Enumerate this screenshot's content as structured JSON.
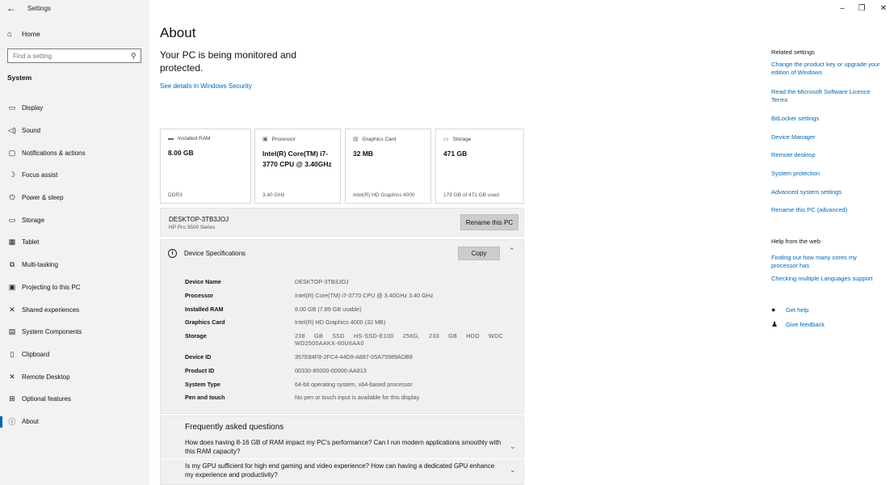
{
  "window": {
    "title": "Settings",
    "back_icon": "arrow-left-icon",
    "controls": {
      "minimize": "–",
      "restore": "❐",
      "close": "✕"
    }
  },
  "sidebar": {
    "home_label": "Home",
    "search_placeholder": "Find a setting",
    "section_label": "System",
    "items": [
      {
        "label": "Display",
        "icon": "monitor-icon",
        "glyph": "▭"
      },
      {
        "label": "Sound",
        "icon": "speaker-icon",
        "glyph": "◁)"
      },
      {
        "label": "Notifications & actions",
        "icon": "notification-icon",
        "glyph": "▢"
      },
      {
        "label": "Focus assist",
        "icon": "moon-icon",
        "glyph": "☽"
      },
      {
        "label": "Power & sleep",
        "icon": "power-icon",
        "glyph": "⏻"
      },
      {
        "label": "Storage",
        "icon": "storage-icon",
        "glyph": "▭"
      },
      {
        "label": "Tablet",
        "icon": "tablet-icon",
        "glyph": "▦"
      },
      {
        "label": "Multi-tasking",
        "icon": "multitask-icon",
        "glyph": "⧉"
      },
      {
        "label": "Projecting to this PC",
        "icon": "projector-icon",
        "glyph": "▣"
      },
      {
        "label": "Shared experiences",
        "icon": "shared-icon",
        "glyph": "✕"
      },
      {
        "label": "System Components",
        "icon": "components-icon",
        "glyph": "▤"
      },
      {
        "label": "Clipboard",
        "icon": "clipboard-icon",
        "glyph": "▯"
      },
      {
        "label": "Remote Desktop",
        "icon": "remote-icon",
        "glyph": "✕"
      },
      {
        "label": "Optional features",
        "icon": "features-icon",
        "glyph": "⊞"
      },
      {
        "label": "About",
        "icon": "info-icon",
        "glyph": "ⓘ"
      }
    ]
  },
  "main": {
    "title": "About",
    "monitor_text": "Your PC is being monitored and protected.",
    "see_details": "See details in Windows Security",
    "cards": [
      {
        "head": "Installed RAM",
        "icon": "ram-icon",
        "value": "8.00 GB",
        "sub": "DDR3"
      },
      {
        "head": "Processor",
        "icon": "cpu-icon",
        "value": "Intel(R) Core(TM) i7-3770 CPU @ 3.40GHz",
        "sub": "3.40 GHz"
      },
      {
        "head": "Graphics Card",
        "icon": "gpu-icon",
        "value": "32 MB",
        "sub": "Intel(R) HD Graphics 4000"
      },
      {
        "head": "Storage",
        "icon": "drive-icon",
        "value": "471 GB",
        "sub": "179 GB of 471 GB used"
      }
    ],
    "pc_name": "DESKTOP-3TB3JOJ",
    "pc_model": "HP Pro 3500 Series",
    "rename_label": "Rename this PC",
    "specs_title": "Device Specifications",
    "copy_label": "Copy",
    "specs": [
      {
        "label": "Device Name",
        "value": "DESKTOP-3TB3JOJ"
      },
      {
        "label": "Processor",
        "value": "Intel(R) Core(TM) i7-3770 CPU @ 3.40GHz   3.40 GHz"
      },
      {
        "label": "Installed RAM",
        "value": "8.00 GB (7.89 GB usable)"
      },
      {
        "label": "Graphics Card",
        "value": "Intel(R) HD Graphics 4000 (32 MB)"
      },
      {
        "label": "Storage",
        "value": "238 GB SSD HS-SSD-E100 256G, 233 GB HDD WDC WD2500AAKX-60U6AA0"
      },
      {
        "label": "Device ID",
        "value": "357E84F8-2FC4-44D9-A887-05A75989ADB8"
      },
      {
        "label": "Product ID",
        "value": "00330-80000-00000-AA813"
      },
      {
        "label": "System Type",
        "value": "64-bit operating system, x64-based processor"
      },
      {
        "label": "Pen and touch",
        "value": "No pen or touch input is available for this display"
      }
    ],
    "faq_title": "Frequently asked questions",
    "faq": [
      "How does having 8-16 GB of RAM impact my PC's performance? Can I run modern applications smoothly with this RAM capacity?",
      "Is my GPU sufficient for high end gaming and video experience? How can having a dedicated GPU enhance my experience and productivity?"
    ]
  },
  "related": {
    "title": "Related settings",
    "links": [
      "Change the product key or upgrade your edition of Windows",
      "Read the Microsoft Software Licence Terms",
      "BitLocker settings",
      "Device Manager",
      "Remote desktop",
      "System protection",
      "Advanced system settings",
      "Rename this PC (advanced)"
    ],
    "help_title": "Help from the web",
    "help_links": [
      "Finding out how many cores my processor has",
      "Checking multiple Languages support"
    ],
    "get_help": "Get help",
    "give_feedback": "Give feedback"
  }
}
